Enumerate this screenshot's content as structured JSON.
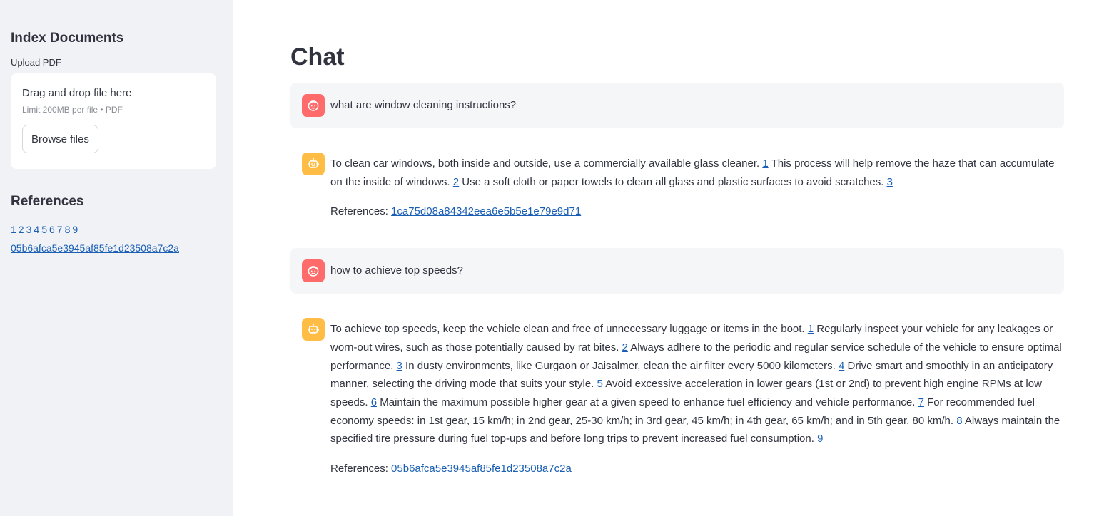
{
  "sidebar": {
    "index_heading": "Index Documents",
    "upload_label": "Upload PDF",
    "dropzone_title": "Drag and drop file here",
    "dropzone_limit": "Limit 200MB per file • PDF",
    "browse_label": "Browse files",
    "references_heading": "References",
    "reference_numbers": [
      "1",
      "2",
      "3",
      "4",
      "5",
      "6",
      "7",
      "8",
      "9"
    ],
    "reference_id": "05b6afca5e3945af85fe1d23508a7c2a"
  },
  "main": {
    "title": "Chat",
    "references_prefix": "References:",
    "messages": [
      {
        "role": "user",
        "text": "what are window cleaning instructions?"
      },
      {
        "role": "assistant",
        "segments": [
          "To clean car windows, both inside and outside, use a commercially available glass cleaner. ",
          "1",
          " This process will help remove the haze that can accumulate on the inside of windows. ",
          "2",
          " Use a soft cloth or paper towels to clean all glass and plastic surfaces to avoid scratches. ",
          "3"
        ],
        "reference_id": "1ca75d08a84342eea6e5b5e1e79e9d71"
      },
      {
        "role": "user",
        "text": "how to achieve top speeds?"
      },
      {
        "role": "assistant",
        "segments": [
          "To achieve top speeds, keep the vehicle clean and free of unnecessary luggage or items in the boot. ",
          "1",
          " Regularly inspect your vehicle for any leakages or worn-out wires, such as those potentially caused by rat bites. ",
          "2",
          " Always adhere to the periodic and regular service schedule of the vehicle to ensure optimal performance. ",
          "3",
          " In dusty environments, like Gurgaon or Jaisalmer, clean the air filter every 5000 kilometers. ",
          "4",
          " Drive smart and smoothly in an anticipatory manner, selecting the driving mode that suits your style. ",
          "5",
          " Avoid excessive acceleration in lower gears (1st or 2nd) to prevent high engine RPMs at low speeds. ",
          "6",
          " Maintain the maximum possible higher gear at a given speed to enhance fuel efficiency and vehicle performance. ",
          "7",
          " For recommended fuel economy speeds: in 1st gear, 15 km/h; in 2nd gear, 25-30 km/h; in 3rd gear, 45 km/h; in 4th gear, 65 km/h; and in 5th gear, 80 km/h. ",
          "8",
          " Always maintain the specified tire pressure during fuel top-ups and before long trips to prevent increased fuel consumption. ",
          "9"
        ],
        "reference_id": "05b6afca5e3945af85fe1d23508a7c2a"
      }
    ]
  },
  "colors": {
    "sidebar_bg": "#f0f2f6",
    "user_avatar": "#ff6b6b",
    "bot_avatar": "#ffbd45",
    "link": "#1a5fb4"
  },
  "icons": {
    "user_avatar": "user-face-icon",
    "bot_avatar": "robot-icon"
  }
}
